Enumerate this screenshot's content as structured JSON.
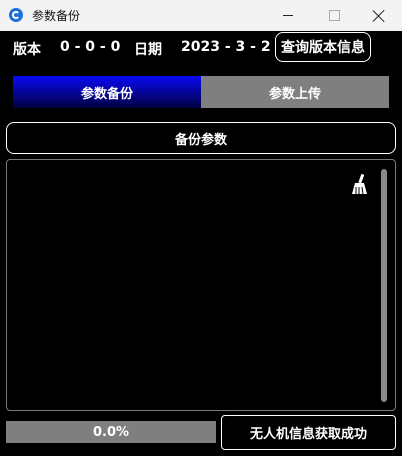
{
  "window": {
    "title": "参数备份"
  },
  "info": {
    "version_label": "版本",
    "version_value": "0 - 0 - 0",
    "date_label": "日期",
    "date_value": "2023 - 3 - 2",
    "query_button": "查询版本信息"
  },
  "tabs": [
    {
      "label": "参数备份",
      "active": true
    },
    {
      "label": "参数上传",
      "active": false
    }
  ],
  "backup_button": "备份参数",
  "log": {
    "clear_icon": "broom-icon",
    "content": ""
  },
  "progress": {
    "value": 0.0,
    "text": "0.0%"
  },
  "status_button": "无人机信息获取成功",
  "colors": {
    "active_tab": "#0a0af5",
    "inactive_tab": "#7f7f7f",
    "progress_track": "#7f7f7f",
    "background": "#000000"
  }
}
